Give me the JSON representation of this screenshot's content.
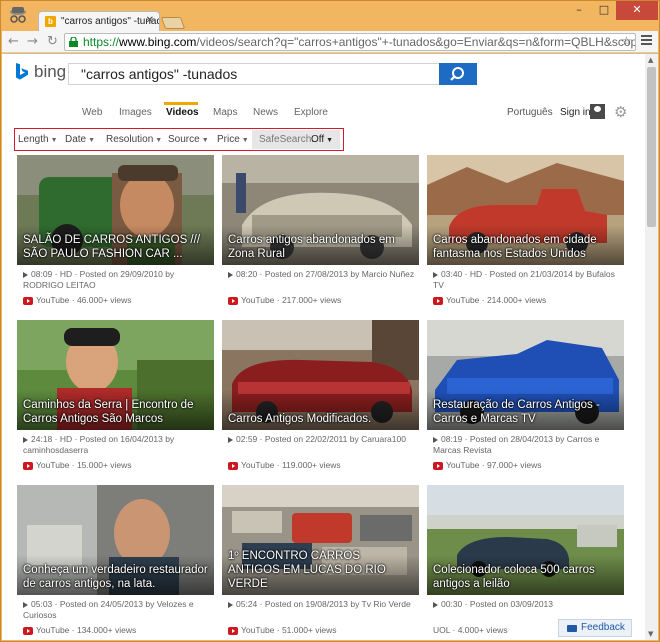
{
  "browser": {
    "tab_title": "\"carros antigos\" -tunado",
    "tab_favicon": "b",
    "url_scheme": "https://",
    "url_host": "www.bing.com",
    "url_path": "/videos/search?q=\"carros+antigos\"+-tunados&go=Enviar&qs=n&form=QBLH&scope=video&pq=",
    "window_controls": {
      "minimize": "–",
      "maximize": "□",
      "close": "✕"
    },
    "back_icon": "←",
    "forward_icon": "→",
    "reload_icon": "↻"
  },
  "bing": {
    "logo_text": "bing",
    "query": "\"carros antigos\" -tunados",
    "scopes": [
      "Web",
      "Images",
      "Videos",
      "Maps",
      "News",
      "Explore"
    ],
    "active_scope": "Videos",
    "language": "Português",
    "signin": "Sign in"
  },
  "filters": {
    "items": [
      "Length",
      "Date",
      "Resolution",
      "Source",
      "Price"
    ],
    "safesearch_label": "SafeSearch:",
    "safesearch_value": "Off"
  },
  "videos": [
    {
      "title": "SALÃO DE CARROS ANTIGOS /// SÃO PAULO FASHION CAR ...",
      "meta": "08:09 · HD · Posted on 29/09/2010 by RODRIGO LEITAO",
      "source": "YouTube · 46.000+ views"
    },
    {
      "title": "Carros antigos abandonados em Zona Rural",
      "meta": "08:20 · Posted on 27/08/2013 by Marcio Nuñez",
      "source": "YouTube · 217.000+ views"
    },
    {
      "title": "Carros abandonados em cidade fantasma nos Estados Unidos",
      "meta": "03:40 · HD · Posted on 21/03/2014 by Bufalos TV",
      "source": "YouTube · 214.000+ views"
    },
    {
      "title": "Caminhos da Serra | Encontro de Carros Antigos São Marcos",
      "meta": "24:18 · HD · Posted on 16/04/2013 by caminhosdaserra",
      "source": "YouTube · 15.000+ views"
    },
    {
      "title": "Carros Antigos Modificados.",
      "meta": "02:59 · Posted on 22/02/2011 by Caruara100",
      "source": "YouTube · 119.000+ views"
    },
    {
      "title": "Restauração de Carros Antigos - Carros e Marcas TV",
      "meta": "08:19 · Posted on 28/04/2013 by Carros e Marcas Revista",
      "source": "YouTube · 97.000+ views"
    },
    {
      "title": "Conheça um verdadeiro restaurador de carros antigos, na lata.",
      "meta": "05:03 · Posted on 24/05/2013 by Velozes e Curiosos",
      "source": "YouTube · 134.000+ views"
    },
    {
      "title": "1º ENCONTRO CARROS ANTIGOS EM LUCAS DO RIO VERDE",
      "meta": "05:24 · Posted on 19/08/2013 by Tv Rio Verde",
      "source": "YouTube · 51.000+ views"
    },
    {
      "title": "Colecionador coloca 500 carros antigos a leilão",
      "meta": "00:30 · Posted on 03/09/2013",
      "source": "UOL · 4.000+ views"
    }
  ],
  "feedback": "Feedback",
  "colors": {
    "accent": "#f0a800",
    "search_button": "#1e6bc4",
    "filter_border": "#d01a2e",
    "window_frame": "#f2b560",
    "youtube_red": "#cc181e"
  }
}
